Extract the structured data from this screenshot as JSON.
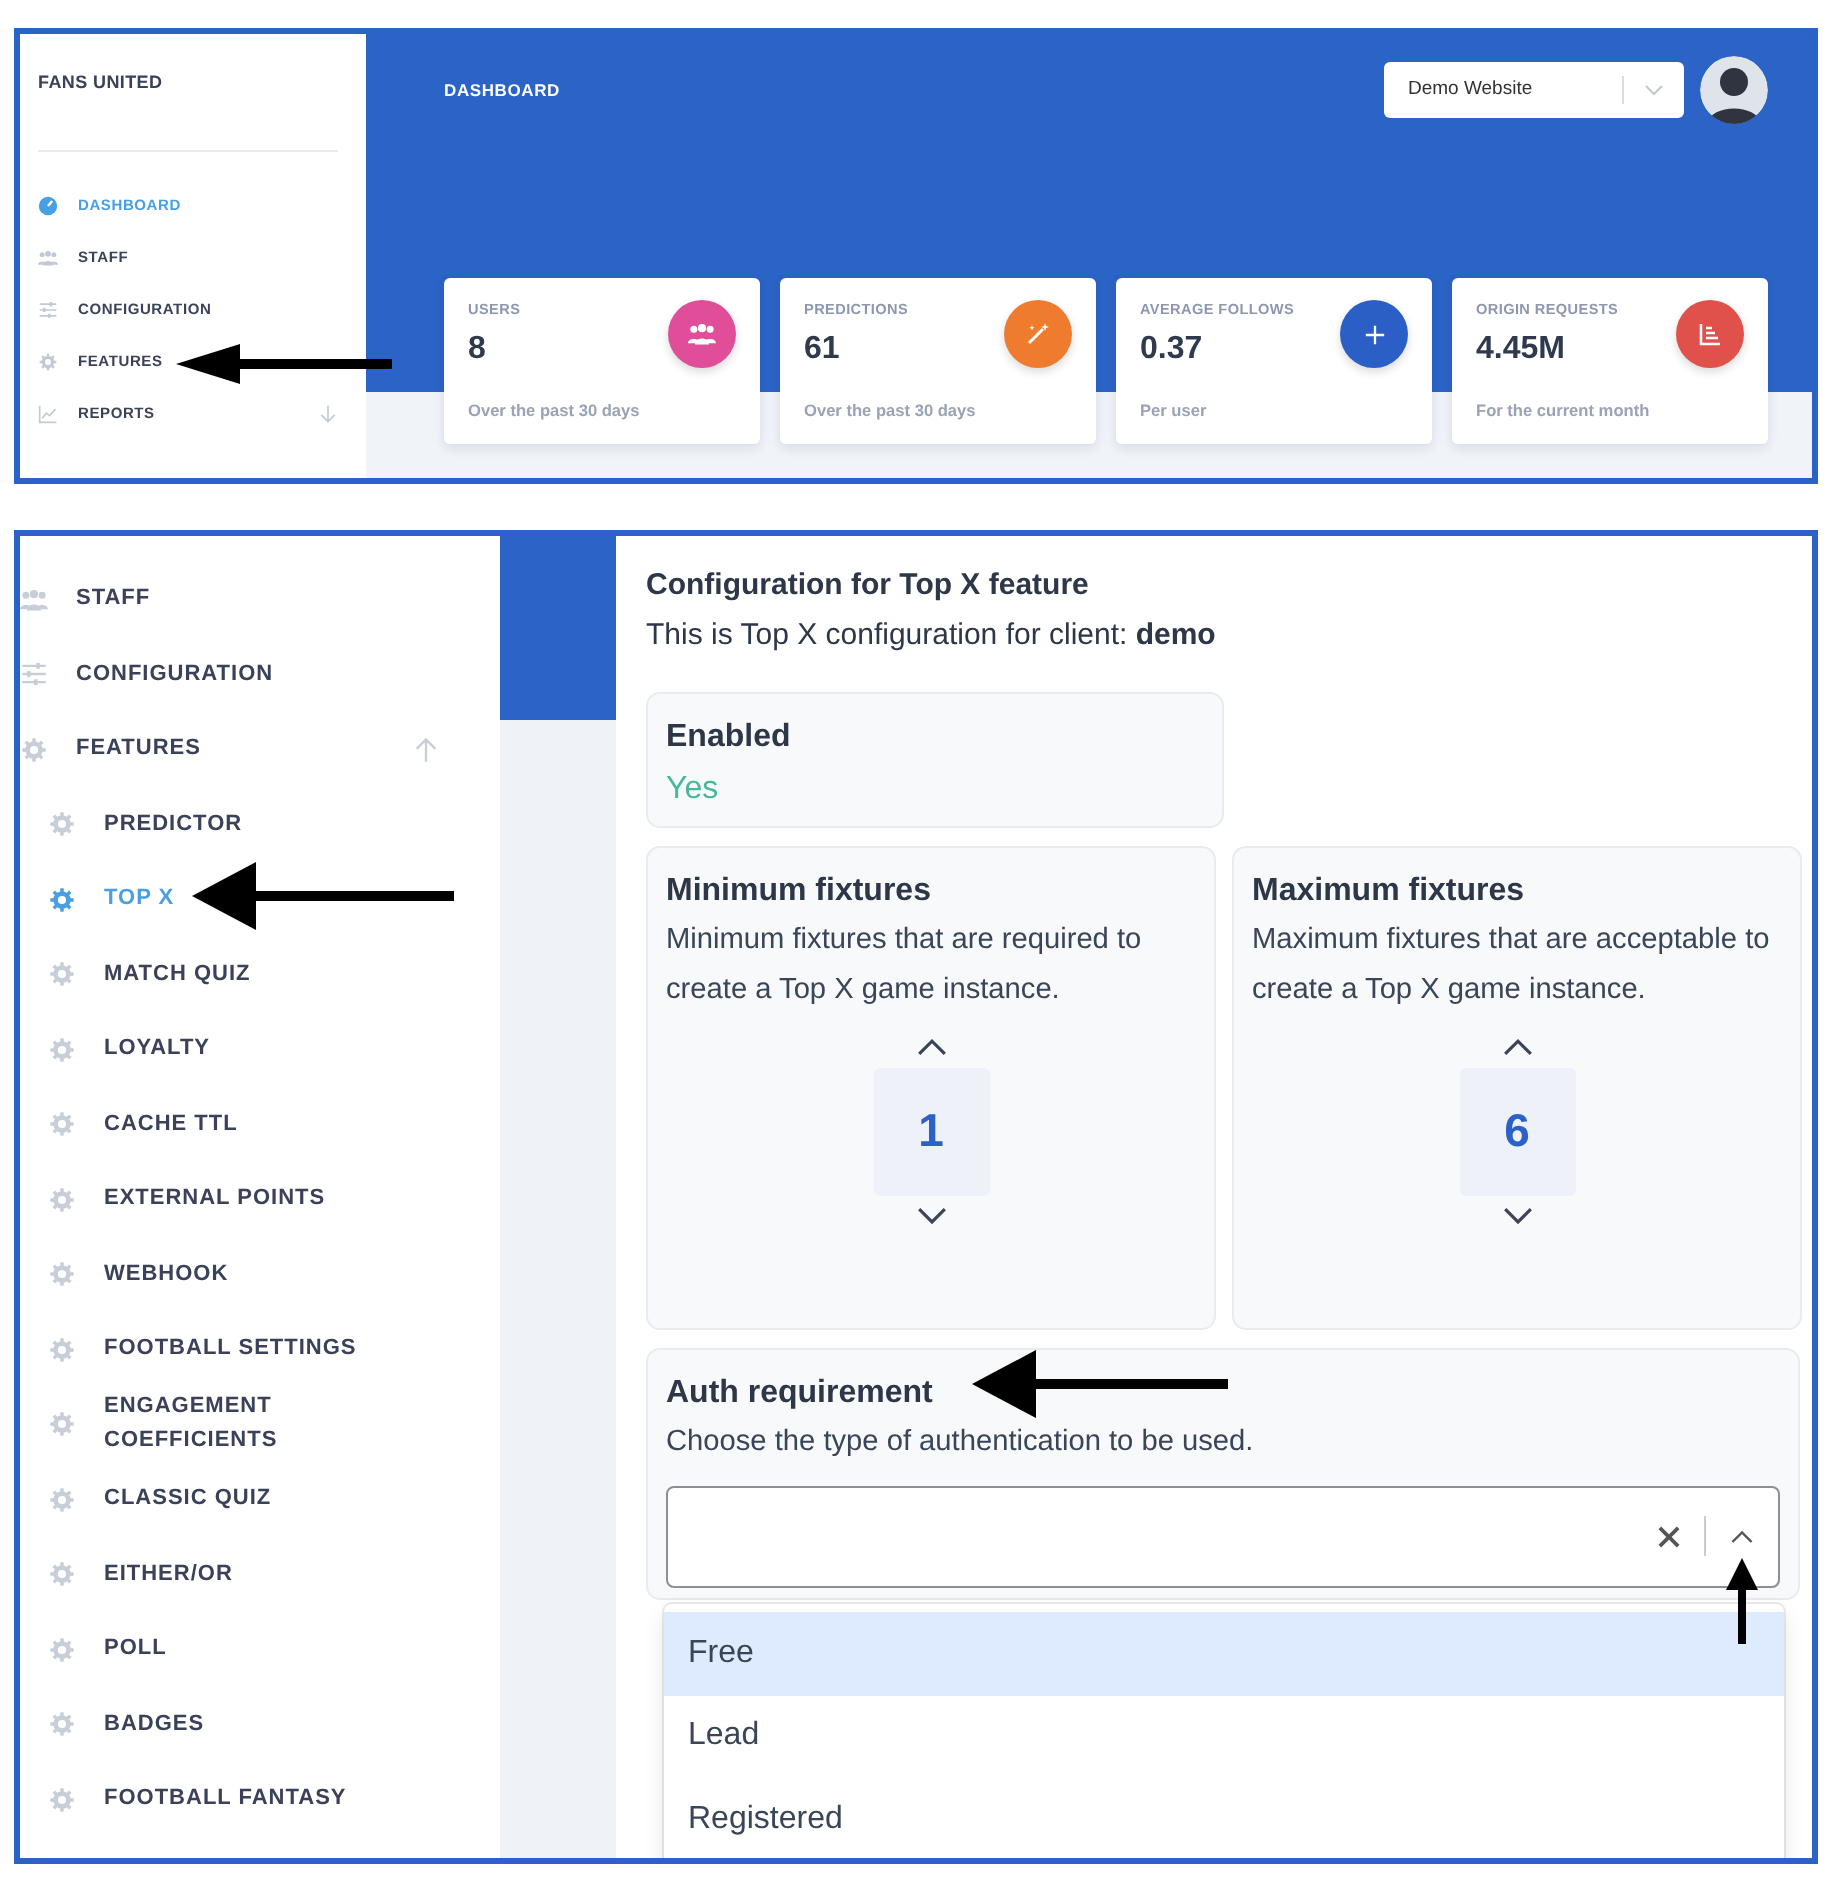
{
  "dashboard_screen": {
    "brand": "FANS UNITED",
    "nav": [
      {
        "label": "DASHBOARD",
        "selected": true
      },
      {
        "label": "STAFF",
        "selected": false
      },
      {
        "label": "CONFIGURATION",
        "selected": false
      },
      {
        "label": "FEATURES",
        "selected": false
      },
      {
        "label": "REPORTS",
        "selected": false,
        "expanded": false
      }
    ],
    "header_title": "DASHBOARD",
    "site_select": {
      "value": "Demo Website"
    },
    "stats": [
      {
        "label": "USERS",
        "value": "8",
        "caption": "Over the past 30 days",
        "color": "#e04e99"
      },
      {
        "label": "PREDICTIONS",
        "value": "61",
        "caption": "Over the past 30 days",
        "color": "#ef7b2f"
      },
      {
        "label": "AVERAGE FOLLOWS",
        "value": "0.37",
        "caption": "Per user",
        "color": "#2c5fc6"
      },
      {
        "label": "ORIGIN REQUESTS",
        "value": "4.45M",
        "caption": "For the current month",
        "color": "#e0514c"
      }
    ]
  },
  "config_screen": {
    "nav": [
      {
        "label": "STAFF",
        "selected": false
      },
      {
        "label": "CONFIGURATION",
        "selected": false
      },
      {
        "label": "FEATURES",
        "selected": false,
        "expanded": true,
        "children": [
          {
            "label": "PREDICTOR",
            "selected": false
          },
          {
            "label": "TOP X",
            "selected": true
          },
          {
            "label": "MATCH QUIZ",
            "selected": false
          },
          {
            "label": "LOYALTY",
            "selected": false
          },
          {
            "label": "CACHE TTL",
            "selected": false
          },
          {
            "label": "EXTERNAL POINTS",
            "selected": false
          },
          {
            "label": "WEBHOOK",
            "selected": false
          },
          {
            "label": "FOOTBALL SETTINGS",
            "selected": false
          },
          {
            "label": "ENGAGEMENT COEFFICIENTS",
            "selected": false
          },
          {
            "label": "CLASSIC QUIZ",
            "selected": false
          },
          {
            "label": "EITHER/OR",
            "selected": false
          },
          {
            "label": "POLL",
            "selected": false
          },
          {
            "label": "BADGES",
            "selected": false
          },
          {
            "label": "FOOTBALL FANTASY",
            "selected": false
          }
        ]
      }
    ],
    "title": "Configuration for Top X feature",
    "subtitle": "This is Top X configuration for client: **demo**",
    "enabled": {
      "label": "Enabled",
      "value": "Yes"
    },
    "fixtures": [
      {
        "title": "Minimum fixtures",
        "description": "Minimum fixtures that are required to create a Top X game instance.",
        "value": "1"
      },
      {
        "title": "Maximum fixtures",
        "description": "Maximum fixtures that are acceptable to create a Top X game instance.",
        "value": "6"
      }
    ],
    "auth": {
      "title": "Auth requirement",
      "description": "Choose the type of authentication to be used.",
      "expanded": true,
      "options": [
        {
          "label": "Free",
          "selected": true
        },
        {
          "label": "Lead",
          "selected": false
        },
        {
          "label": "Registered",
          "selected": false
        }
      ]
    }
  }
}
